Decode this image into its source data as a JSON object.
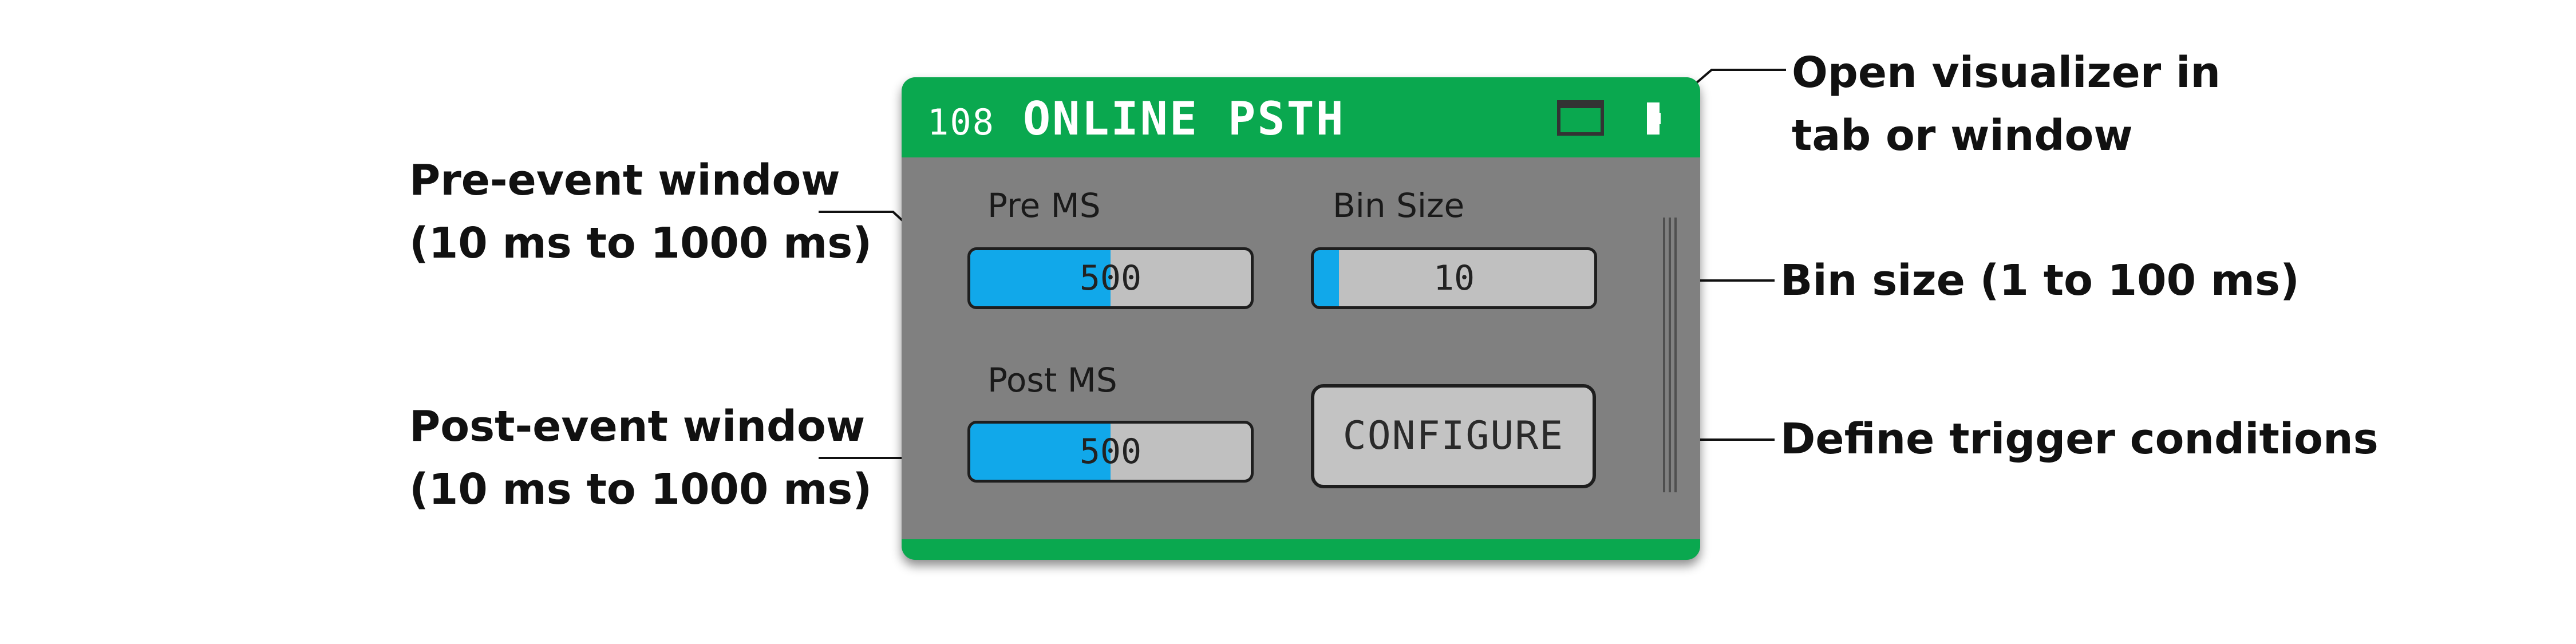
{
  "node": {
    "id": "108",
    "title": "ONLINE PSTH",
    "header_color": "#0aa84f",
    "header_icons": [
      "tab-icon",
      "window-icon"
    ]
  },
  "pre_ms": {
    "label": "Pre MS",
    "value": "500",
    "fraction": 0.5
  },
  "bin_size": {
    "label": "Bin Size",
    "value": "10",
    "fraction": 0.09
  },
  "post_ms": {
    "label": "Post MS",
    "value": "500",
    "fraction": 0.5
  },
  "configure_label": "CONFIGURE",
  "colors": {
    "slider_fill": "#11a8ea",
    "slider_track": "#c0c0c0",
    "panel": "#808080"
  },
  "annotations": {
    "visualizer": [
      "Open visualizer in",
      "tab or window"
    ],
    "pre_event": [
      "Pre-event window",
      "(10 ms to 1000 ms)"
    ],
    "bin_size": [
      "Bin size (1 to 100 ms)"
    ],
    "post_event": [
      "Post-event window",
      "(10 ms to 1000 ms)"
    ],
    "trigger": [
      "Define trigger conditions"
    ]
  }
}
